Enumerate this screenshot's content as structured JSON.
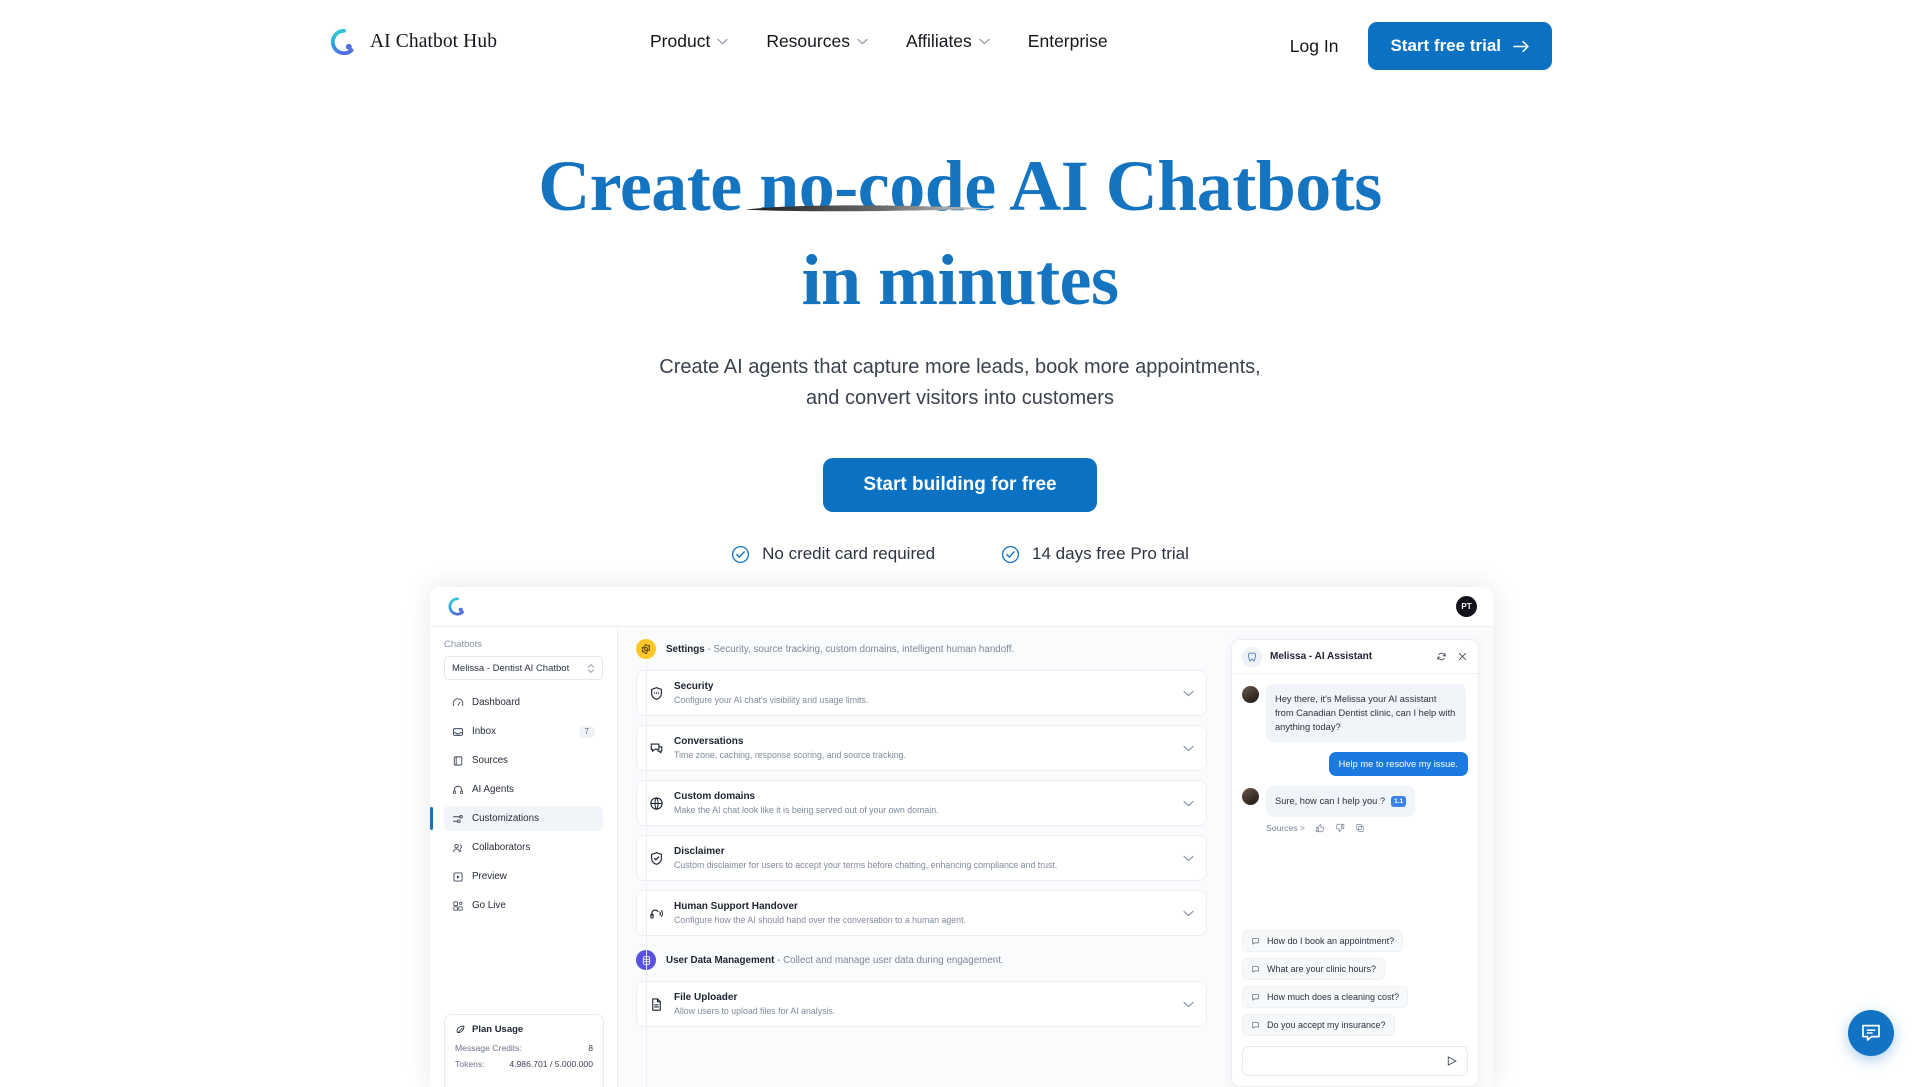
{
  "brand": {
    "name": "AI Chatbot Hub",
    "logo_icon": "chatbot-hub-logo",
    "accent": "#0b71c2"
  },
  "nav": {
    "links": [
      {
        "label": "Product",
        "has_dropdown": true
      },
      {
        "label": "Resources",
        "has_dropdown": true
      },
      {
        "label": "Affiliates",
        "has_dropdown": true
      },
      {
        "label": "Enterprise",
        "has_dropdown": false
      }
    ],
    "login_label": "Log In",
    "cta_label": "Start free trial",
    "cta_icon": "arrow-right-icon"
  },
  "hero": {
    "headline_line1": "Create no-code AI Chatbots",
    "headline_line2": "in minutes",
    "headline_color": "#1574c0",
    "subhead_line1": "Create AI agents that capture more leads, book more appointments,",
    "subhead_line2": "and convert visitors into customers",
    "cta_label": "Start building for free",
    "assurances": [
      {
        "icon": "check-circle-icon",
        "label": "No credit card required"
      },
      {
        "icon": "check-circle-icon",
        "label": "14 days free Pro trial"
      }
    ]
  },
  "app": {
    "topbar": {
      "logo_icon": "app-logo-icon",
      "avatar_initials": "PT"
    },
    "sidebar": {
      "section_label": "Chatbots",
      "select_value": "Melissa - Dentist AI Chatbot",
      "select_icon": "chevron-up-down-icon",
      "items": [
        {
          "label": "Dashboard",
          "icon": "gauge-icon",
          "active": false,
          "badge": ""
        },
        {
          "label": "Inbox",
          "icon": "inbox-icon",
          "active": false,
          "badge": "7"
        },
        {
          "label": "Sources",
          "icon": "book-icon",
          "active": false,
          "badge": ""
        },
        {
          "label": "AI Agents",
          "icon": "headset-icon",
          "active": false,
          "badge": ""
        },
        {
          "label": "Customizations",
          "icon": "sliders-icon",
          "active": true,
          "badge": ""
        },
        {
          "label": "Collaborators",
          "icon": "users-icon",
          "active": false,
          "badge": ""
        },
        {
          "label": "Preview",
          "icon": "play-square-icon",
          "active": false,
          "badge": ""
        },
        {
          "label": "Go Live",
          "icon": "rocket-grid-icon",
          "active": false,
          "badge": ""
        }
      ],
      "plan": {
        "title": "Plan Usage",
        "icon": "leaf-icon",
        "rows": [
          {
            "label": "Message Credits:",
            "value": "8"
          },
          {
            "label": "Tokens:",
            "value": "4.986.701 / 5.000.000"
          }
        ]
      }
    },
    "sections": [
      {
        "badge_icon": "gear-icon",
        "badge_color": "#ffc727",
        "title": "Settings",
        "summary": "- Security, source tracking, custom domains, intelligent human handoff.",
        "cards": [
          {
            "icon": "shield-dots-icon",
            "title": "Security",
            "desc": "Configure your AI chat's visibility and usage limits."
          },
          {
            "icon": "chat-bubbles-icon",
            "title": "Conversations",
            "desc": "Time zone, caching, response scoring, and source tracking."
          },
          {
            "icon": "globe-icon",
            "title": "Custom domains",
            "desc": "Make the AI chat look like it is being served out of your own domain."
          },
          {
            "icon": "shield-check-icon",
            "title": "Disclaimer",
            "desc": "Custom disclaimer for users to accept your terms before chatting, enhancing compliance and trust."
          },
          {
            "icon": "headset-support-icon",
            "title": "Human Support Handover",
            "desc": "Configure how the AI should hand over the conversation to a human agent."
          }
        ]
      },
      {
        "badge_icon": "database-icon",
        "badge_color": "#5753e0",
        "title": "User Data Management",
        "summary": "- Collect and manage user data during engagement.",
        "cards": [
          {
            "icon": "file-icon",
            "title": "File Uploader",
            "desc": "Allow users to upload files for AI analysis."
          }
        ]
      }
    ],
    "chat": {
      "header_title": "Melissa - AI Assistant",
      "header_avatar_icon": "tooth-icon",
      "refresh_icon": "refresh-icon",
      "close_icon": "close-icon",
      "messages": [
        {
          "from": "bot",
          "text": "Hey there, it's Melissa your AI assistant from Canadian Dentist clinic, can I help with anything today?",
          "citation": ""
        },
        {
          "from": "user",
          "text": "Help me to resolve my issue.",
          "citation": ""
        },
        {
          "from": "bot",
          "text": "Sure, how can I help you ?",
          "citation": "1.1"
        }
      ],
      "tools": {
        "sources_label": "Sources >",
        "icons": [
          "thumbs-up-icon",
          "thumbs-down-icon",
          "copy-icon"
        ]
      },
      "suggestions": [
        "How do I book an appointment?",
        "What are your clinic hours?",
        "How much does a cleaning cost?",
        "Do you accept my insurance?"
      ],
      "input_placeholder": "",
      "input_value": "",
      "send_icon": "send-icon"
    }
  },
  "floating_chat": {
    "icon": "chat-bubble-icon",
    "color": "#1273c4"
  }
}
